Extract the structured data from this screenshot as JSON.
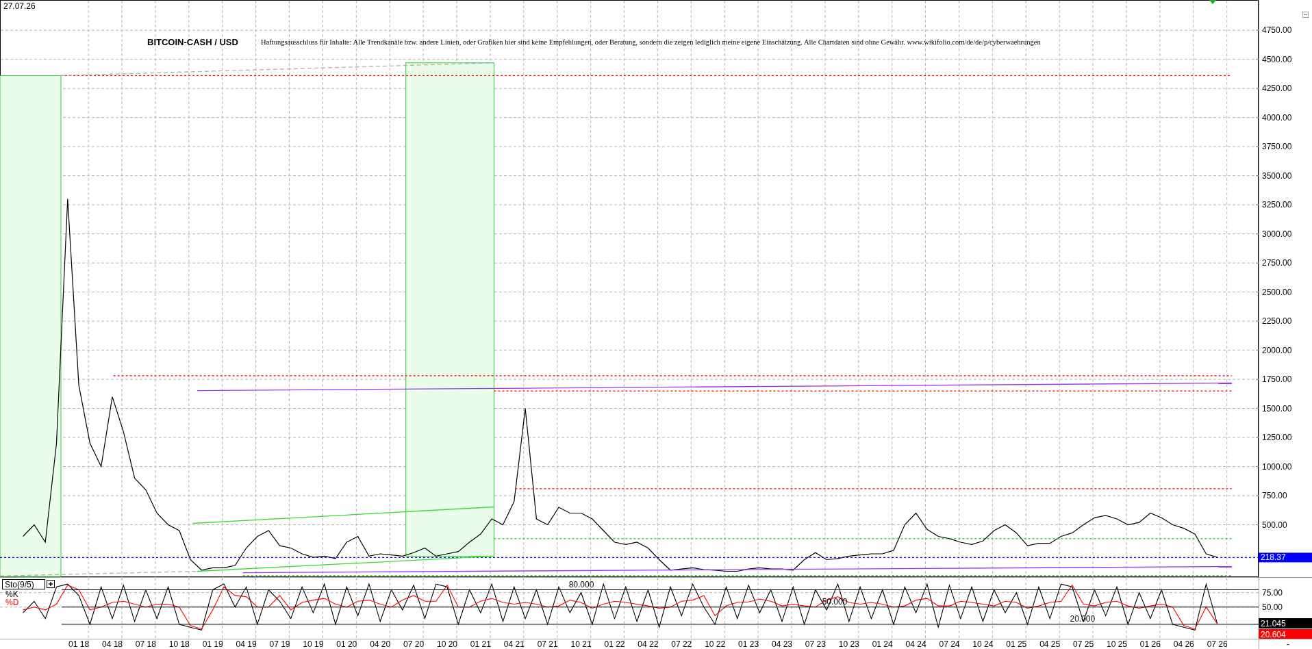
{
  "price_chart": {
    "date": "27.07.26",
    "disclaimer": "Haftungsausschluss für Inhalte: Alle Trendkanäle bzw. andere Linien, oder Grafiken hier sind keine Empfehlungen, oder Beratung, sondern die zeigen lediglich meine eigene Einschätzung. Alle Chartdaten sind ohne Gewähr.  www.wikifolio.com/de/de/p/cyberwaehrungen",
    "last_price": "218.37",
    "chart_data": {
      "type": "line",
      "title": "BITCOIN-CASH / USD",
      "series": [
        {
          "color": "#000000",
          "values": [
            400,
            500,
            350,
            1200,
            3300,
            1700,
            1200,
            1000,
            1600,
            1300,
            900,
            800,
            600,
            500,
            450,
            200,
            110,
            130,
            130,
            150,
            300,
            400,
            450,
            320,
            300,
            250,
            220,
            230,
            210,
            350,
            400,
            230,
            250,
            240,
            230,
            260,
            300,
            230,
            250,
            270,
            350,
            420,
            550,
            500,
            700,
            1500,
            550,
            500,
            650,
            600,
            600,
            550,
            450,
            350,
            330,
            350,
            300,
            200,
            110,
            120,
            130,
            115,
            110,
            100,
            100,
            120,
            130,
            120,
            120,
            110,
            200,
            260,
            200,
            210,
            230,
            240,
            250,
            250,
            280,
            500,
            600,
            460,
            400,
            380,
            350,
            330,
            360,
            450,
            500,
            430,
            320,
            340,
            340,
            400,
            430,
            500,
            560,
            580,
            550,
            500,
            520,
            600,
            560,
            500,
            470,
            420,
            250,
            220
          ]
        }
      ],
      "grid": true,
      "ylim": [
        50,
        5010
      ],
      "yticks": [
        {
          "value": 500,
          "label": "500.00"
        },
        {
          "value": 750,
          "label": "750.00"
        },
        {
          "value": 1000,
          "label": "1000.00"
        },
        {
          "value": 1250,
          "label": "1250.00"
        },
        {
          "value": 1500,
          "label": "1500.00"
        },
        {
          "value": 1750,
          "label": "1750.00"
        },
        {
          "value": 2000,
          "label": "2000.00"
        },
        {
          "value": 2250,
          "label": "2250.00"
        },
        {
          "value": 2500,
          "label": "2500.00"
        },
        {
          "value": 2750,
          "label": "2750.00"
        },
        {
          "value": 3000,
          "label": "3000.00"
        },
        {
          "value": 3250,
          "label": "3250.00"
        },
        {
          "value": 3500,
          "label": "3500.00"
        },
        {
          "value": 3750,
          "label": "3750.00"
        },
        {
          "value": 4000,
          "label": "4000.00"
        },
        {
          "value": 4250,
          "label": "4250.00"
        },
        {
          "value": 4500,
          "label": "4500.00"
        },
        {
          "value": 4750,
          "label": "4750.00"
        }
      ]
    }
  },
  "oscillator": {
    "corner_button": "-",
    "last_values": [
      "21.045",
      "20.604"
    ],
    "chart_data": {
      "type": "line",
      "title": "Sto(9/5)",
      "categories": [
        null,
        null,
        null,
        null,
        null,
        "01 18",
        null,
        null,
        "04 18",
        null,
        null,
        "07 18",
        null,
        null,
        "10 18",
        null,
        null,
        "01 19",
        null,
        null,
        "04 19",
        null,
        null,
        "07 19",
        null,
        null,
        "10 19",
        null,
        null,
        "01 20",
        null,
        null,
        "04 20",
        null,
        null,
        "07 20",
        null,
        null,
        "10 20",
        null,
        null,
        "01 21",
        null,
        null,
        "04 21",
        null,
        null,
        "07 21",
        null,
        null,
        "10 21",
        null,
        null,
        "01 22",
        null,
        null,
        "04 22",
        null,
        null,
        "07 22",
        null,
        null,
        "10 22",
        null,
        null,
        "01 23",
        null,
        null,
        "04 23",
        null,
        null,
        "07 23",
        null,
        null,
        "10 23",
        null,
        null,
        "01 24",
        null,
        null,
        "04 24",
        null,
        null,
        "07 24",
        null,
        null,
        "10 24",
        null,
        null,
        "01 25",
        null,
        null,
        "04 25",
        null,
        null,
        "07 25",
        null,
        null,
        "10 25",
        null,
        null,
        "01 26",
        null,
        null,
        "04 26",
        null,
        null,
        "07 26"
      ],
      "series": [
        {
          "name": "%K",
          "color": "#000000",
          "values": [
            40,
            60,
            30,
            85,
            90,
            70,
            20,
            85,
            30,
            88,
            25,
            80,
            30,
            85,
            20,
            15,
            10,
            80,
            90,
            50,
            85,
            20,
            80,
            60,
            30,
            85,
            40,
            90,
            20,
            85,
            35,
            90,
            25,
            80,
            45,
            88,
            30,
            90,
            85,
            20,
            80,
            40,
            90,
            25,
            85,
            30,
            80,
            20,
            85,
            40,
            75,
            20,
            90,
            30,
            85,
            25,
            80,
            15,
            85,
            35,
            90,
            50,
            20,
            85,
            30,
            88,
            40,
            80,
            25,
            85,
            20,
            80,
            45,
            90,
            25,
            85,
            30,
            80,
            20,
            85,
            40,
            90,
            15,
            88,
            30,
            85,
            25,
            80,
            40,
            75,
            20,
            85,
            30,
            90,
            85,
            25,
            80,
            35,
            85,
            20,
            75,
            30,
            80,
            20,
            15,
            10,
            90,
            21
          ]
        },
        {
          "name": "%D",
          "color": "#ff0000",
          "values": [
            45,
            50,
            45,
            55,
            88,
            80,
            45,
            50,
            58,
            60,
            55,
            50,
            55,
            55,
            50,
            18,
            12,
            45,
            85,
            70,
            68,
            50,
            50,
            70,
            45,
            58,
            62,
            65,
            55,
            50,
            60,
            62,
            55,
            50,
            62,
            70,
            60,
            60,
            88,
            50,
            50,
            60,
            65,
            58,
            55,
            58,
            55,
            50,
            52,
            62,
            58,
            48,
            55,
            60,
            58,
            55,
            52,
            48,
            50,
            60,
            62,
            70,
            35,
            52,
            58,
            59,
            64,
            60,
            52,
            55,
            52,
            50,
            62,
            68,
            58,
            55,
            58,
            55,
            50,
            52,
            62,
            65,
            52,
            52,
            60,
            58,
            55,
            52,
            60,
            58,
            48,
            52,
            58,
            60,
            88,
            55,
            52,
            58,
            60,
            52,
            48,
            52,
            55,
            50,
            18,
            12,
            50,
            21
          ]
        }
      ],
      "grid": true,
      "ylim": [
        -5,
        102
      ],
      "yticks": [
        {
          "value": 50,
          "label": "50.00"
        },
        {
          "value": 75,
          "label": "75.00"
        }
      ]
    },
    "level_labels": [
      "80.000",
      "50.000",
      "20.000"
    ]
  }
}
